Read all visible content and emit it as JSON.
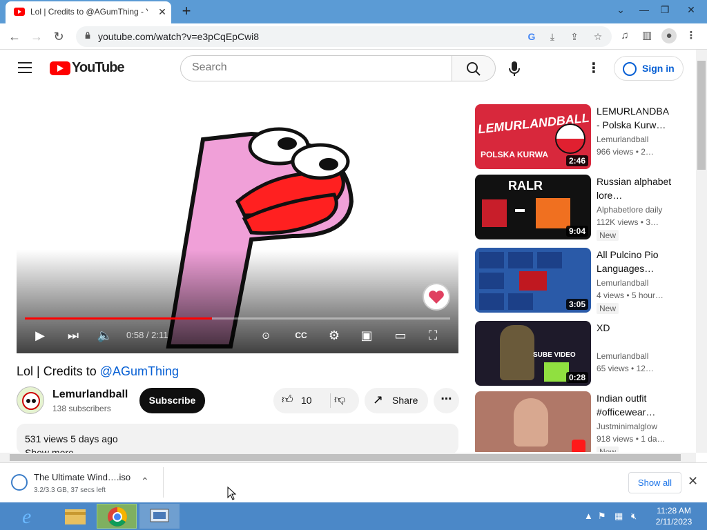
{
  "browser": {
    "tab_title": "Lol | Credits to @AGumThing - Y",
    "url": "youtube.com/watch?v=e3pCqEpCwi8"
  },
  "youtube": {
    "wordmark": "YouTube",
    "search_placeholder": "Search",
    "signin_label": "Sign in"
  },
  "player": {
    "time": "0:58 / 2:11",
    "progress": 0.44
  },
  "video": {
    "title_prefix": "Lol | Credits to ",
    "title_mention": "@AGumThing",
    "channel": "Lemurlandball",
    "subscribers": "138 subscribers",
    "subscribe_label": "Subscribe",
    "likes": "10",
    "share_label": "Share",
    "stats": "531 views  5 days ago",
    "show_more": "Show more"
  },
  "recommendations": [
    {
      "title": "LEMURLANDBA - Polska Kurw…",
      "channel": "Lemurlandball",
      "meta": "966 views  • 2…",
      "duration": "2:46",
      "new": "",
      "thumb_text": "LEMURLANDBALL",
      "thumb_sub": "POLSKA KURWA"
    },
    {
      "title": "Russian alphabet lore…",
      "channel": "Alphabetlore daily",
      "meta": "112K views  • 3…",
      "duration": "9:04",
      "new": "New",
      "thumb_text": "RALR",
      "thumb_sub": ""
    },
    {
      "title": "All Pulcino Pio Languages…",
      "channel": "Lemurlandball",
      "meta": "4 views  • 5 hour…",
      "duration": "3:05",
      "new": "New",
      "thumb_text": "",
      "thumb_sub": ""
    },
    {
      "title": "XD",
      "channel": "Lemurlandball",
      "meta": "65 views  • 12…",
      "duration": "0:28",
      "new": "",
      "thumb_text": "SUBE VIDEO",
      "thumb_sub": ""
    },
    {
      "title": "Indian outfit #officewear…",
      "channel": "Justminimalglow",
      "meta": "918 views  • 1 da…",
      "duration": "",
      "new": "New",
      "thumb_text": "",
      "thumb_sub": ""
    }
  ],
  "download": {
    "filename": "The Ultimate Wind….iso",
    "status": "3.2/3.3 GB, 37 secs left",
    "show_all": "Show all"
  },
  "taskbar": {
    "time": "11:28 AM",
    "date": "2/11/2023"
  }
}
